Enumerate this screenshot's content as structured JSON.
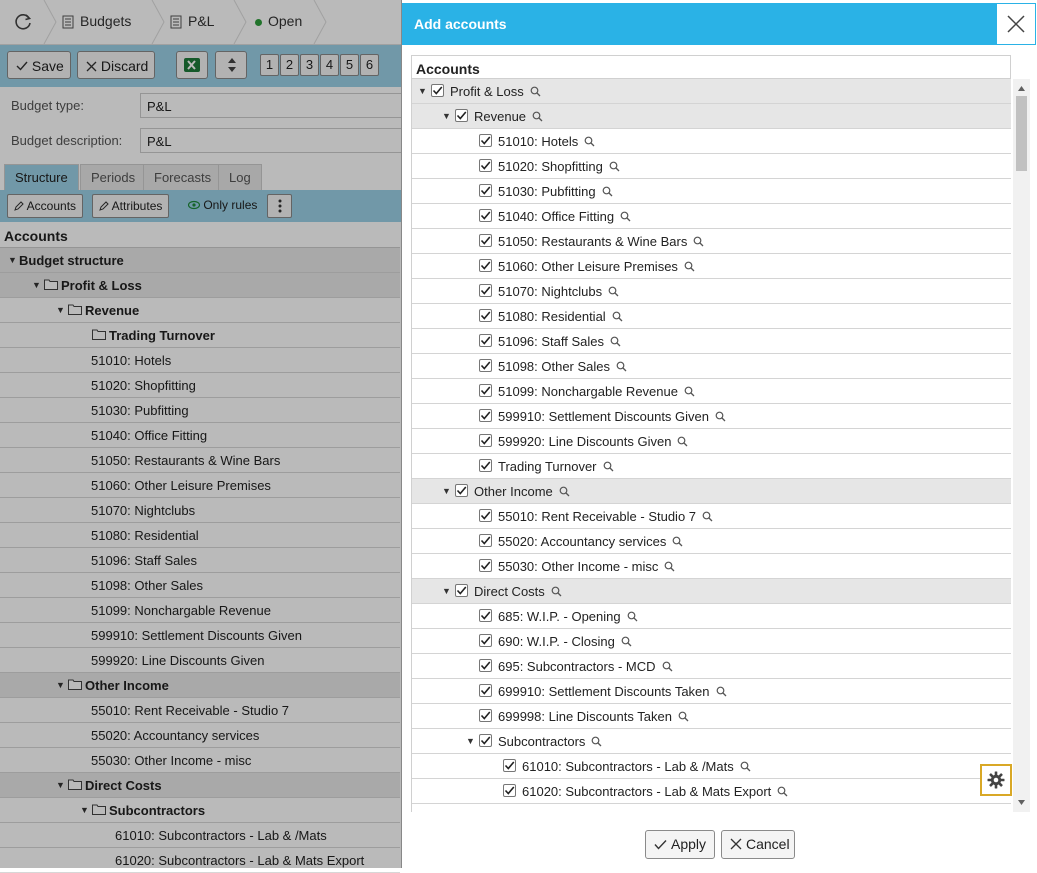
{
  "topbar": {
    "crumbs": [
      "Budgets",
      "P&L",
      "Open"
    ]
  },
  "toolbar": {
    "save_label": "Save",
    "discard_label": "Discard",
    "pages": [
      "1",
      "2",
      "3",
      "4",
      "5",
      "6"
    ]
  },
  "fields": {
    "budget_type_label": "Budget type:",
    "budget_type_value": "P&L",
    "budget_description_label": "Budget description:",
    "budget_description_value": "P&L"
  },
  "tabs": [
    "Structure",
    "Periods",
    "Forecasts",
    "Log"
  ],
  "subbar": {
    "accounts_label": "Accounts",
    "attributes_label": "Attributes",
    "only_rules_label": "Only rules"
  },
  "background_list": {
    "header": "Accounts",
    "rows": [
      {
        "label": "Budget structure",
        "level": 0,
        "group": true,
        "expander": true,
        "folder": false
      },
      {
        "label": "Profit & Loss",
        "level": 1,
        "group": true,
        "expander": true,
        "folder": true
      },
      {
        "label": "Revenue",
        "level": 2,
        "group": false,
        "bold": true,
        "expander": true,
        "folder": true
      },
      {
        "label": "Trading Turnover",
        "level": 3,
        "group": false,
        "bold": true,
        "expander": false,
        "folder": true
      },
      {
        "label": "51010: Hotels",
        "level": 4,
        "group": false
      },
      {
        "label": "51020: Shopfitting",
        "level": 4,
        "group": false
      },
      {
        "label": "51030: Pubfitting",
        "level": 4,
        "group": false
      },
      {
        "label": "51040: Office Fitting",
        "level": 4,
        "group": false
      },
      {
        "label": "51050: Restaurants & Wine Bars",
        "level": 4,
        "group": false
      },
      {
        "label": "51060: Other Leisure Premises",
        "level": 4,
        "group": false
      },
      {
        "label": "51070: Nightclubs",
        "level": 4,
        "group": false
      },
      {
        "label": "51080: Residential",
        "level": 4,
        "group": false
      },
      {
        "label": "51096: Staff Sales",
        "level": 4,
        "group": false
      },
      {
        "label": "51098: Other Sales",
        "level": 4,
        "group": false
      },
      {
        "label": "51099: Nonchargable Revenue",
        "level": 4,
        "group": false
      },
      {
        "label": "599910: Settlement Discounts Given",
        "level": 4,
        "group": false
      },
      {
        "label": "599920: Line Discounts Given",
        "level": 4,
        "group": false
      },
      {
        "label": "Other Income",
        "level": 2,
        "group": true,
        "expander": true,
        "folder": true
      },
      {
        "label": "55010: Rent Receivable - Studio 7",
        "level": 4,
        "group": false
      },
      {
        "label": "55020: Accountancy services",
        "level": 4,
        "group": false
      },
      {
        "label": "55030: Other Income - misc",
        "level": 4,
        "group": false
      },
      {
        "label": "Direct Costs",
        "level": 2,
        "group": true,
        "expander": true,
        "folder": true
      },
      {
        "label": "Subcontractors",
        "level": 3,
        "group": false,
        "bold": true,
        "expander": true,
        "folder": true
      },
      {
        "label": "61010: Subcontractors - Lab & /Mats",
        "level": 5,
        "group": false
      },
      {
        "label": "61020: Subcontractors - Lab & Mats Export",
        "level": 5,
        "group": false
      }
    ]
  },
  "dialog": {
    "title": "Add accounts",
    "list_header": "Accounts",
    "apply_label": "Apply",
    "cancel_label": "Cancel",
    "rows": [
      {
        "label": "Profit & Loss",
        "level": 0,
        "group": true,
        "checked": true
      },
      {
        "label": "Revenue",
        "level": 1,
        "group": true,
        "checked": true
      },
      {
        "label": "51010: Hotels",
        "level": 2,
        "group": false,
        "checked": true
      },
      {
        "label": "51020: Shopfitting",
        "level": 2,
        "group": false,
        "checked": true
      },
      {
        "label": "51030: Pubfitting",
        "level": 2,
        "group": false,
        "checked": true
      },
      {
        "label": "51040: Office Fitting",
        "level": 2,
        "group": false,
        "checked": true
      },
      {
        "label": "51050: Restaurants & Wine Bars",
        "level": 2,
        "group": false,
        "checked": true
      },
      {
        "label": "51060: Other Leisure Premises",
        "level": 2,
        "group": false,
        "checked": true
      },
      {
        "label": "51070: Nightclubs",
        "level": 2,
        "group": false,
        "checked": true
      },
      {
        "label": "51080: Residential",
        "level": 2,
        "group": false,
        "checked": true
      },
      {
        "label": "51096: Staff Sales",
        "level": 2,
        "group": false,
        "checked": true
      },
      {
        "label": "51098: Other Sales",
        "level": 2,
        "group": false,
        "checked": true
      },
      {
        "label": "51099: Nonchargable Revenue",
        "level": 2,
        "group": false,
        "checked": true
      },
      {
        "label": "599910: Settlement Discounts Given",
        "level": 2,
        "group": false,
        "checked": true
      },
      {
        "label": "599920: Line Discounts Given",
        "level": 2,
        "group": false,
        "checked": true
      },
      {
        "label": "Trading Turnover",
        "level": 2,
        "group": false,
        "checked": true
      },
      {
        "label": "Other Income",
        "level": 1,
        "group": true,
        "checked": true
      },
      {
        "label": "55010: Rent Receivable - Studio 7",
        "level": 2,
        "group": false,
        "checked": true
      },
      {
        "label": "55020: Accountancy services",
        "level": 2,
        "group": false,
        "checked": true
      },
      {
        "label": "55030: Other Income - misc",
        "level": 2,
        "group": false,
        "checked": true
      },
      {
        "label": "Direct Costs",
        "level": 1,
        "group": true,
        "checked": true
      },
      {
        "label": "685: W.I.P. - Opening",
        "level": 2,
        "group": false,
        "checked": true
      },
      {
        "label": "690: W.I.P. - Closing",
        "level": 2,
        "group": false,
        "checked": true
      },
      {
        "label": "695: Subcontractors - MCD",
        "level": 2,
        "group": false,
        "checked": true
      },
      {
        "label": "699910: Settlement Discounts Taken",
        "level": 2,
        "group": false,
        "checked": true
      },
      {
        "label": "699998: Line Discounts Taken",
        "level": 2,
        "group": false,
        "checked": true
      },
      {
        "label": "Subcontractors",
        "level": 2,
        "group": false,
        "expander": true,
        "checked": true
      },
      {
        "label": "61010: Subcontractors - Lab & /Mats",
        "level": 3,
        "group": false,
        "checked": true
      },
      {
        "label": "61020: Subcontractors - Lab & Mats Export",
        "level": 3,
        "group": false,
        "checked": true
      }
    ]
  }
}
